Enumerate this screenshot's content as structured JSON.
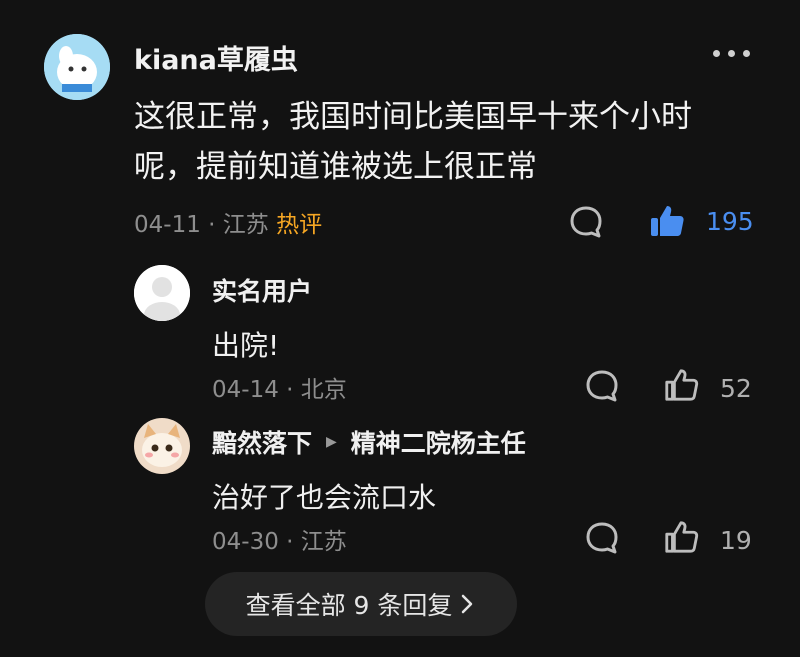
{
  "comment": {
    "username": "kiana草履虫",
    "line1": "这很正常，我国时间比美国早十来个小时",
    "line2": "呢，提前知道谁被选上很正常",
    "date": "04-11",
    "sep": "·",
    "location": "江苏",
    "hot_badge": "热评",
    "likes": "195",
    "liked_color": "#4a8ef0"
  },
  "replies": [
    {
      "name": "实名用户",
      "text": "出院!",
      "date": "04-14",
      "location": "北京",
      "likes": "52"
    },
    {
      "name": "黯然落下",
      "reply_to": "精神二院杨主任",
      "text": "治好了也会流口水",
      "date": "04-30",
      "location": "江苏",
      "likes": "19"
    }
  ],
  "view_all": "查看全部 9 条回复",
  "icons": {
    "more": "more-dots-icon",
    "comment": "comment-bubble-icon",
    "like": "thumbs-up-icon",
    "chevron": "chevron-right-icon"
  }
}
